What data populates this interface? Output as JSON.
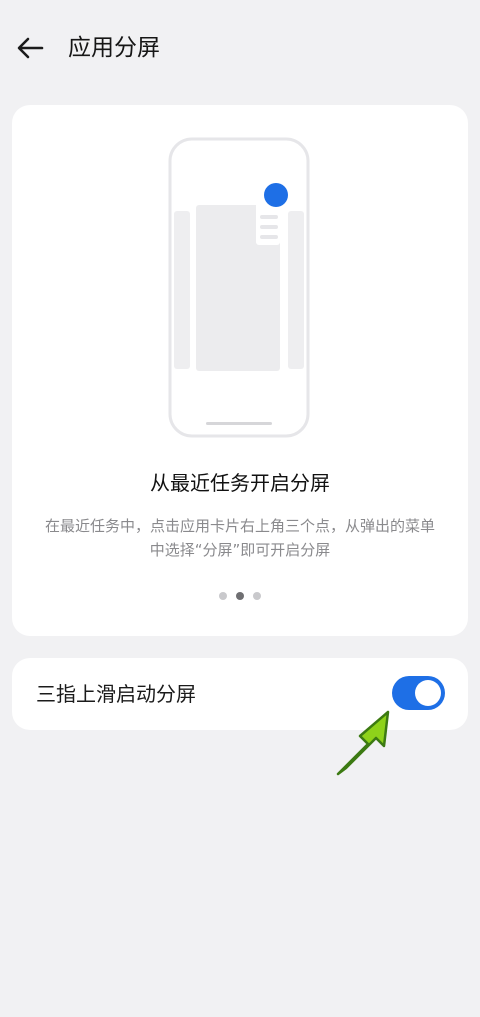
{
  "header": {
    "title": "应用分屏",
    "back_icon": "back-arrow-icon"
  },
  "feature_card": {
    "heading": "从最近任务开启分屏",
    "description": "在最近任务中，点击应用卡片右上角三个点，从弹出的菜单中选择“分屏”即可开启分屏",
    "carousel": {
      "total_pages": 3,
      "current_page": 2
    }
  },
  "toggle_row": {
    "label": "三指上滑启动分屏",
    "state": "on"
  },
  "colors": {
    "accent": "#1e6fe6",
    "page_bg": "#f1f1f3",
    "card_bg": "#ffffff",
    "annotation_arrow": "#8ed21a"
  }
}
